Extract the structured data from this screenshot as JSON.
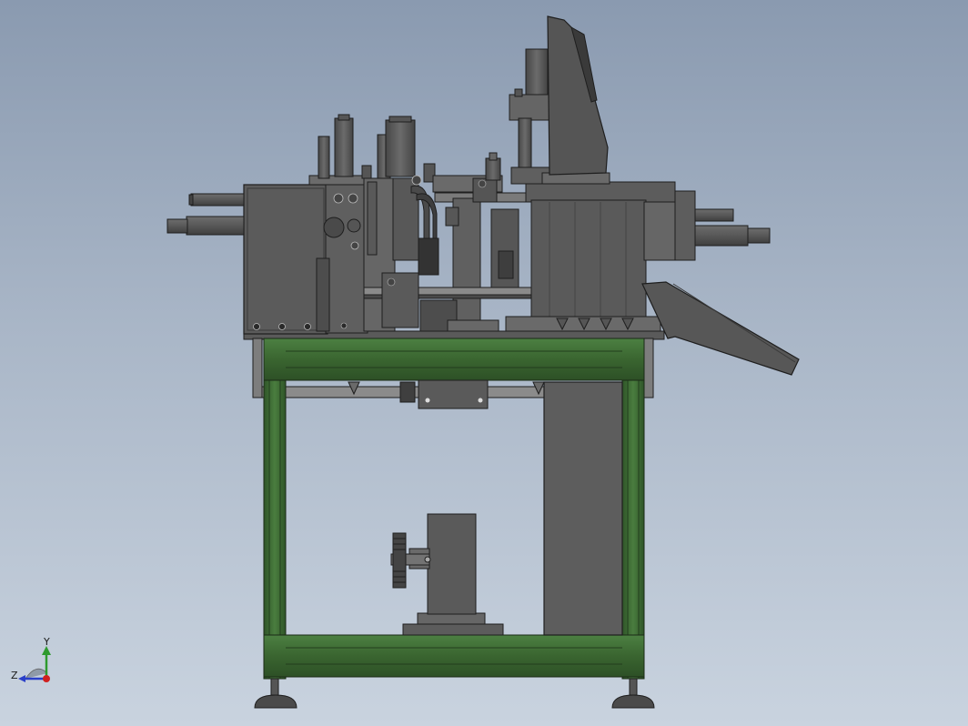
{
  "view": {
    "background_top": "#8a9ab0",
    "background_bottom": "#c9d3df"
  },
  "colors": {
    "frame_green": "#3f6b35",
    "frame_green_dark": "#2b4a25",
    "frame_green_light": "#56894a",
    "steel_dark": "#4a4a4a",
    "steel_mid": "#5e5e5e",
    "steel_light": "#777777",
    "outline": "#1e1e1e",
    "axis_y": "#2e9a2e",
    "axis_z": "#2a3fc8",
    "axis_origin": "#d02020"
  },
  "triad": {
    "y_label": "Y",
    "z_label": "Z"
  }
}
